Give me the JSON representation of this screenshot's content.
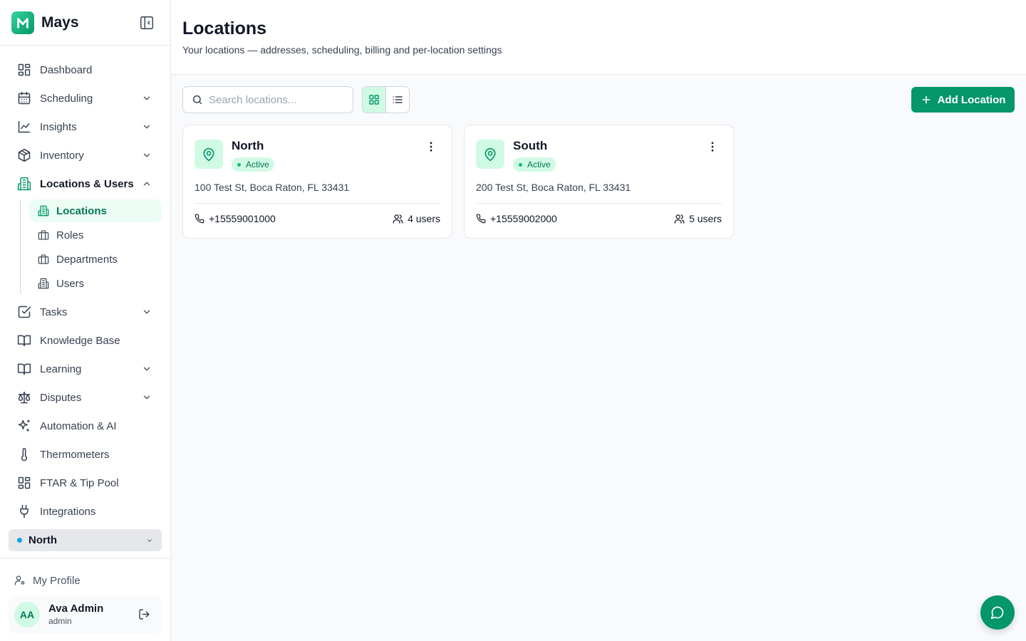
{
  "app": {
    "name": "Mays"
  },
  "nav": {
    "items": [
      {
        "label": "Dashboard"
      },
      {
        "label": "Scheduling"
      },
      {
        "label": "Insights"
      },
      {
        "label": "Inventory"
      },
      {
        "label": "Locations & Users"
      },
      {
        "label": "Tasks"
      },
      {
        "label": "Knowledge Base"
      },
      {
        "label": "Learning"
      },
      {
        "label": "Disputes"
      },
      {
        "label": "Automation & AI"
      },
      {
        "label": "Thermometers"
      },
      {
        "label": "FTAR & Tip Pool"
      },
      {
        "label": "Integrations"
      }
    ],
    "sub_items": [
      {
        "label": "Locations"
      },
      {
        "label": "Roles"
      },
      {
        "label": "Departments"
      },
      {
        "label": "Users"
      }
    ]
  },
  "location_selector": {
    "value": "North",
    "dot_color": "#0ea5e9"
  },
  "sidebar_footer": {
    "profile_label": "My Profile",
    "user": {
      "initials": "AA",
      "name": "Ava Admin",
      "role": "admin"
    }
  },
  "page": {
    "title": "Locations",
    "subtitle": "Your locations — addresses, scheduling, billing and per-location settings"
  },
  "toolbar": {
    "search_placeholder": "Search locations...",
    "add_button_label": "Add Location"
  },
  "locations": [
    {
      "name": "North",
      "status": "Active",
      "address": "100 Test St, Boca Raton, FL 33431",
      "phone": "+15559001000",
      "users": "4 users"
    },
    {
      "name": "South",
      "status": "Active",
      "address": "200 Test St, Boca Raton, FL 33431",
      "phone": "+15559002000",
      "users": "5 users"
    }
  ],
  "colors": {
    "accent": "#059669",
    "accent_light": "#d1fae5",
    "status_active": "#10b981"
  }
}
